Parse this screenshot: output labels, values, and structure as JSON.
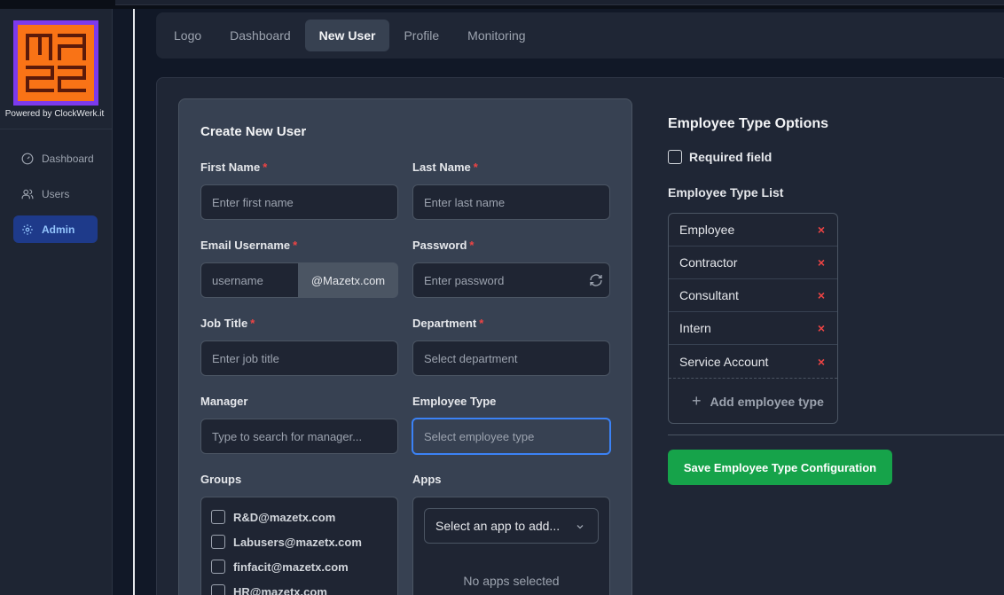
{
  "sidebar": {
    "powered_by": "Powered by ClockWerk.it",
    "items": [
      {
        "label": "Dashboard",
        "icon": "gauge-icon"
      },
      {
        "label": "Users",
        "icon": "users-icon"
      },
      {
        "label": "Admin",
        "icon": "gear-icon"
      }
    ]
  },
  "tabs": [
    "Logo",
    "Dashboard",
    "New User",
    "Profile",
    "Monitoring"
  ],
  "active_tab": "New User",
  "form": {
    "title": "Create New User",
    "first_name": {
      "label": "First Name",
      "placeholder": "Enter first name"
    },
    "last_name": {
      "label": "Last Name",
      "placeholder": "Enter last name"
    },
    "email": {
      "label": "Email Username",
      "placeholder": "username",
      "suffix": "@Mazetx.com"
    },
    "password": {
      "label": "Password",
      "placeholder": "Enter password"
    },
    "job_title": {
      "label": "Job Title",
      "placeholder": "Enter job title"
    },
    "department": {
      "label": "Department",
      "placeholder": "Select department"
    },
    "manager": {
      "label": "Manager",
      "placeholder": "Type to search for manager..."
    },
    "employee_type": {
      "label": "Employee Type",
      "placeholder": "Select employee type"
    },
    "required_mark": "*",
    "groups": {
      "label": "Groups",
      "items": [
        "R&D@mazetx.com",
        "Labusers@mazetx.com",
        "finfacit@mazetx.com",
        "HR@mazetx.com"
      ]
    },
    "apps": {
      "label": "Apps",
      "select_placeholder": "Select an app to add...",
      "empty_text": "No apps selected"
    }
  },
  "options": {
    "title": "Employee Type Options",
    "required_field_label": "Required field",
    "list_label": "Employee Type List",
    "types": [
      "Employee",
      "Contractor",
      "Consultant",
      "Intern",
      "Service Account"
    ],
    "remove_symbol": "×",
    "add_label": "Add employee type",
    "save_label": "Save Employee Type Configuration"
  },
  "colors": {
    "background": "#111827",
    "panel": "#1f2635",
    "card": "#374152",
    "accent_blue": "#3b82f6",
    "active_nav": "#1e3a8a",
    "save_green": "#16a34a",
    "required_red": "#ef4444",
    "logo_orange": "#f97316",
    "logo_purple": "#7c3aed"
  }
}
